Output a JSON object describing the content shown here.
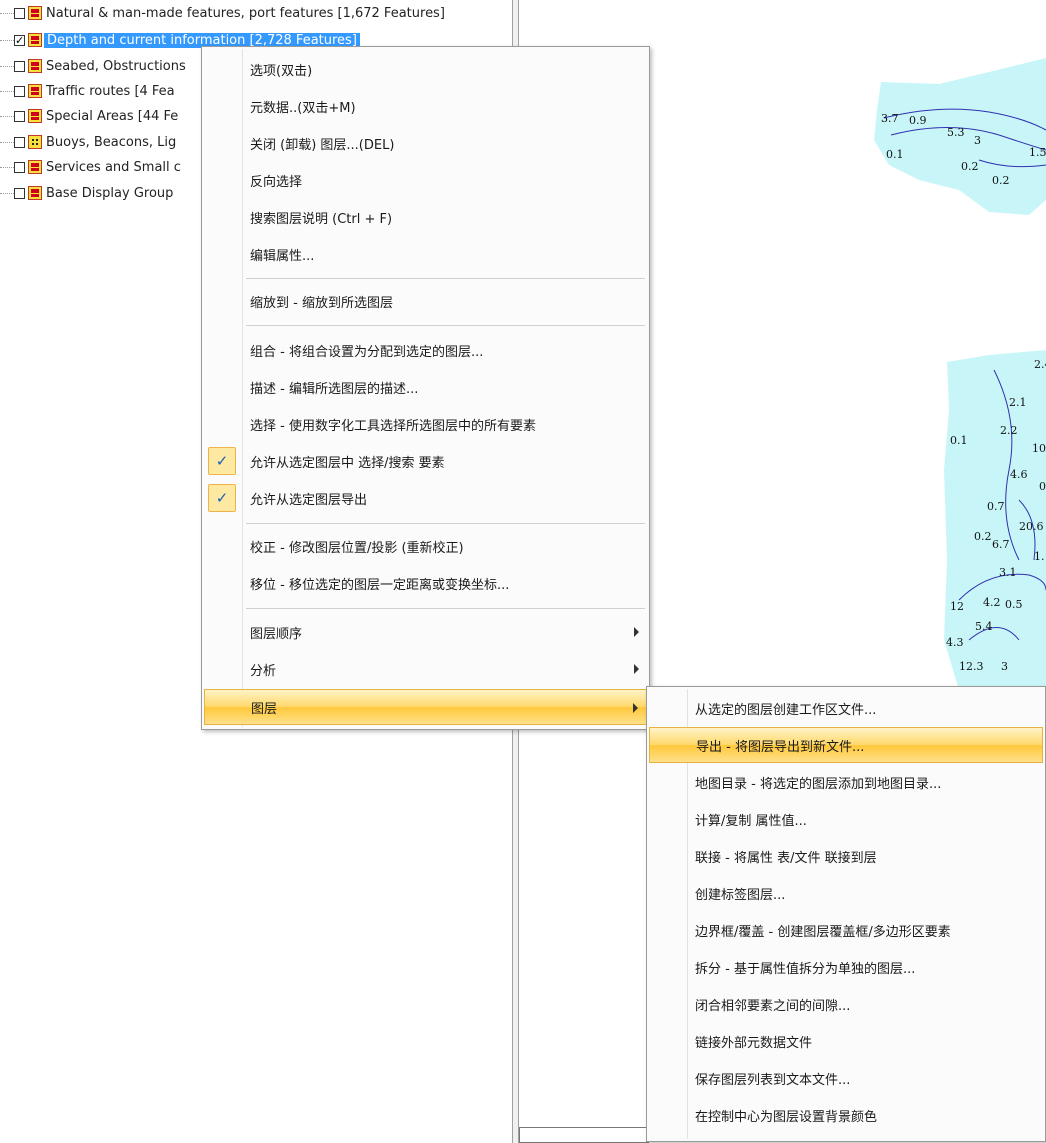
{
  "colors": {
    "selection": "#3399ff",
    "map_water": "#c8f6f8",
    "map_line": "#3030b0",
    "menu_highlight": "#ffd86a"
  },
  "tree": {
    "items": [
      {
        "label": "Natural & man-made features, port features [1,672 Features]",
        "checked": false,
        "icon": "area-layer-icon"
      },
      {
        "label": "Depth and current information [2,728 Features]",
        "checked": true,
        "icon": "area-layer-icon"
      },
      {
        "label": "Seabed, Obstructions",
        "checked": false,
        "icon": "area-layer-icon"
      },
      {
        "label": "Traffic routes [4 Fea",
        "checked": false,
        "icon": "area-layer-icon"
      },
      {
        "label": "Special Areas [44 Fe",
        "checked": false,
        "icon": "area-layer-icon"
      },
      {
        "label": "Buoys, Beacons, Lig",
        "checked": false,
        "icon": "point-layer-icon"
      },
      {
        "label": "Services and Small c",
        "checked": false,
        "icon": "area-layer-icon"
      },
      {
        "label": "Base Display Group",
        "checked": false,
        "icon": "area-layer-icon"
      }
    ]
  },
  "menu": {
    "items": [
      {
        "label": "选项(双击)"
      },
      {
        "label": "元数据..(双击+M)"
      },
      {
        "label": "关闭 (卸载) 图层...(DEL)"
      },
      {
        "label": "反向选择"
      },
      {
        "label": "搜索图层说明 (Ctrl + F)"
      },
      {
        "label": "编辑属性..."
      },
      {
        "label": "缩放到 - 缩放到所选图层"
      },
      {
        "label": "组合 - 将组合设置为分配到选定的图层..."
      },
      {
        "label": "描述 - 编辑所选图层的描述..."
      },
      {
        "label": "选择 - 使用数字化工具选择所选图层中的所有要素"
      },
      {
        "label": "允许从选定图层中 选择/搜索 要素",
        "checked": true,
        "check_mark": "✓"
      },
      {
        "label": "允许从选定图层导出",
        "checked": true,
        "check_mark": "✓"
      },
      {
        "label": "校正 - 修改图层位置/投影 (重新校正)"
      },
      {
        "label": "移位 - 移位选定的图层一定距离或变换坐标..."
      },
      {
        "label": "图层顺序",
        "submenu": true
      },
      {
        "label": "分析",
        "submenu": true
      },
      {
        "label": "图层",
        "submenu": true,
        "highlighted": true
      }
    ]
  },
  "submenu": {
    "items": [
      {
        "label": "从选定的图层创建工作区文件..."
      },
      {
        "label": "导出 - 将图层导出到新文件...",
        "highlighted": true
      },
      {
        "label": "地图目录 - 将选定的图层添加到地图目录..."
      },
      {
        "label": "计算/复制 属性值..."
      },
      {
        "label": "联接 - 将属性 表/文件 联接到层"
      },
      {
        "label": "创建标签图层..."
      },
      {
        "label": "边界框/覆盖 - 创建图层覆盖框/多边形区要素"
      },
      {
        "label": "拆分 - 基于属性值拆分为单独的图层..."
      },
      {
        "label": "闭合相邻要素之间的间隙..."
      },
      {
        "label": "链接外部元数据文件"
      },
      {
        "label": "保存图层列表到文本文件..."
      },
      {
        "label": "在控制中心为图层设置背景颜色"
      }
    ]
  },
  "map": {
    "soundings": [
      "3.7",
      "0.9",
      "5.3",
      "3",
      "1.5",
      "0.1",
      "0.2",
      "0.2",
      "2.4",
      "2.1",
      "2.2",
      "10",
      "0.1",
      "4.6",
      "0",
      "0.7",
      "20.6",
      "0.2",
      "6.7",
      "1.",
      "3.1",
      "12",
      "4.2",
      "0.5",
      "5.4",
      "4.3",
      "12.3",
      "3"
    ]
  }
}
